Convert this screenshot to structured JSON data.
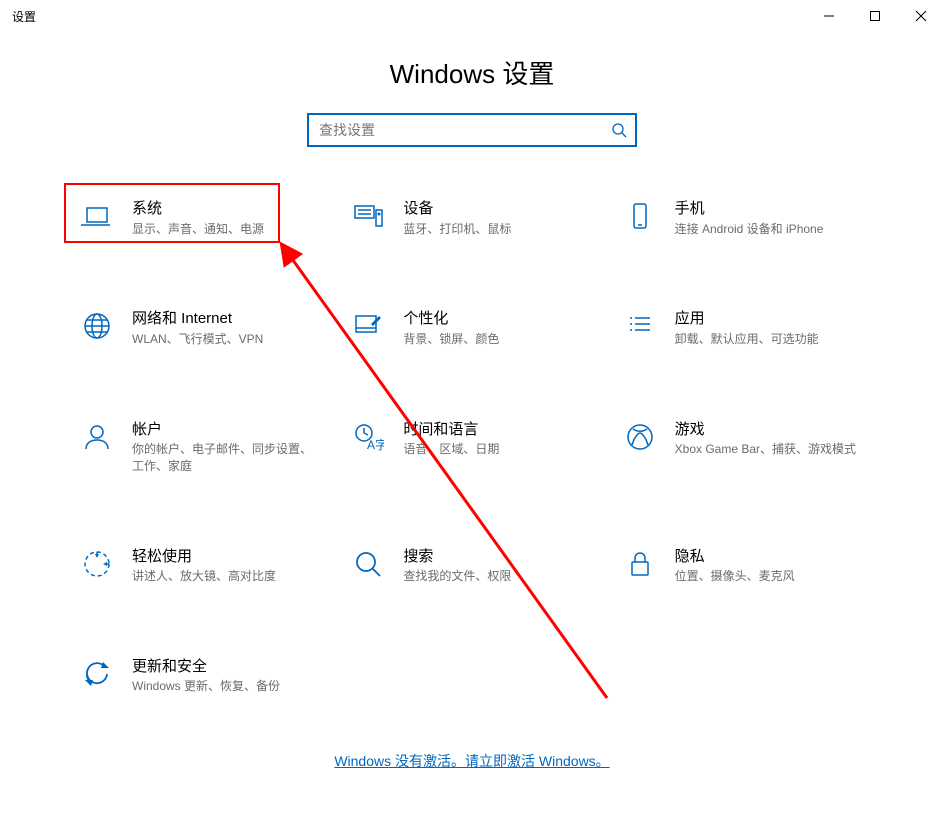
{
  "window": {
    "title": "设置"
  },
  "page": {
    "heading": "Windows 设置",
    "search_placeholder": "查找设置",
    "activation_notice": "Windows 没有激活。请立即激活 Windows。"
  },
  "tiles": [
    {
      "id": "system",
      "title": "系统",
      "desc": "显示、声音、通知、电源"
    },
    {
      "id": "devices",
      "title": "设备",
      "desc": "蓝牙、打印机、鼠标"
    },
    {
      "id": "phone",
      "title": "手机",
      "desc": "连接 Android 设备和 iPhone"
    },
    {
      "id": "network",
      "title": "网络和 Internet",
      "desc": "WLAN、飞行模式、VPN"
    },
    {
      "id": "personal",
      "title": "个性化",
      "desc": "背景、锁屏、颜色"
    },
    {
      "id": "apps",
      "title": "应用",
      "desc": "卸载、默认应用、可选功能"
    },
    {
      "id": "accounts",
      "title": "帐户",
      "desc": "你的帐户、电子邮件、同步设置、工作、家庭"
    },
    {
      "id": "time",
      "title": "时间和语言",
      "desc": "语音、区域、日期"
    },
    {
      "id": "gaming",
      "title": "游戏",
      "desc": "Xbox Game Bar、捕获、游戏模式"
    },
    {
      "id": "ease",
      "title": "轻松使用",
      "desc": "讲述人、放大镜、高对比度"
    },
    {
      "id": "search",
      "title": "搜索",
      "desc": "查找我的文件、权限"
    },
    {
      "id": "privacy",
      "title": "隐私",
      "desc": "位置、摄像头、麦克风"
    },
    {
      "id": "update",
      "title": "更新和安全",
      "desc": "Windows 更新、恢复、备份"
    }
  ]
}
